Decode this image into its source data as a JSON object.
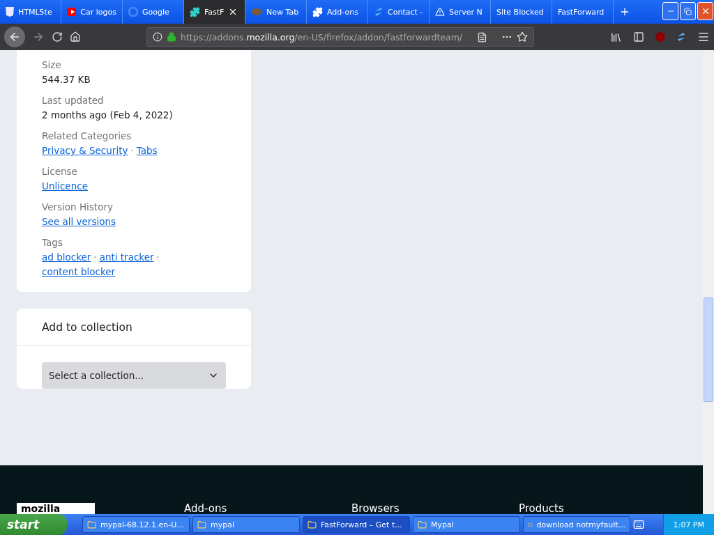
{
  "tabs": [
    {
      "label": "HTML5te",
      "selected": false
    },
    {
      "label": "Car logos",
      "selected": false
    },
    {
      "label": "Google",
      "selected": false
    },
    {
      "label": "FastF",
      "selected": true
    },
    {
      "label": "New Tab",
      "selected": false
    },
    {
      "label": "Add-ons",
      "selected": false
    },
    {
      "label": "Contact -",
      "selected": false
    },
    {
      "label": "Server N",
      "selected": false
    },
    {
      "label": "Site Blocked",
      "selected": false
    },
    {
      "label": "FastForward",
      "selected": false
    }
  ],
  "address": {
    "prefix": "https://addons.",
    "domain": "mozilla.org",
    "path": "/en-US/firefox/addon/fastforwardteam/"
  },
  "details": [
    {
      "label": "Size",
      "values": [
        {
          "text": "544.37 KB",
          "kind": "text"
        }
      ]
    },
    {
      "label": "Last updated",
      "values": [
        {
          "text": "2 months ago (Feb 4, 2022)",
          "kind": "text"
        }
      ]
    },
    {
      "label": "Related Categories",
      "values": [
        {
          "text": "Privacy & Security",
          "kind": "link",
          "separator": "·"
        },
        {
          "text": "Tabs",
          "kind": "link"
        }
      ]
    },
    {
      "label": "License",
      "values": [
        {
          "text": "Unlicence",
          "kind": "link"
        }
      ]
    },
    {
      "label": "Version History",
      "values": [
        {
          "text": "See all versions",
          "kind": "link"
        }
      ]
    },
    {
      "label": "Tags",
      "values": [
        {
          "text": "ad blocker",
          "kind": "link",
          "separator": "·"
        },
        {
          "text": "anti tracker",
          "kind": "link",
          "separator": "·"
        },
        {
          "text": "content blocker",
          "kind": "link"
        }
      ]
    }
  ],
  "collection": {
    "title": "Add to collection",
    "select": "Select a collection..."
  },
  "footer": {
    "logo": "mozilla",
    "headings": [
      "Add-ons",
      "Browsers",
      "Products"
    ]
  },
  "taskbar": {
    "start": "start",
    "items": [
      {
        "label": "mypal-68.12.1.en-U...",
        "selected": false
      },
      {
        "label": "mypal",
        "selected": false
      },
      {
        "label": "FastForward – Get t...",
        "selected": true
      },
      {
        "label": "Mypal",
        "selected": false
      },
      {
        "label": "download notmyfault...",
        "selected": false
      }
    ],
    "time": "1:07 PM"
  }
}
